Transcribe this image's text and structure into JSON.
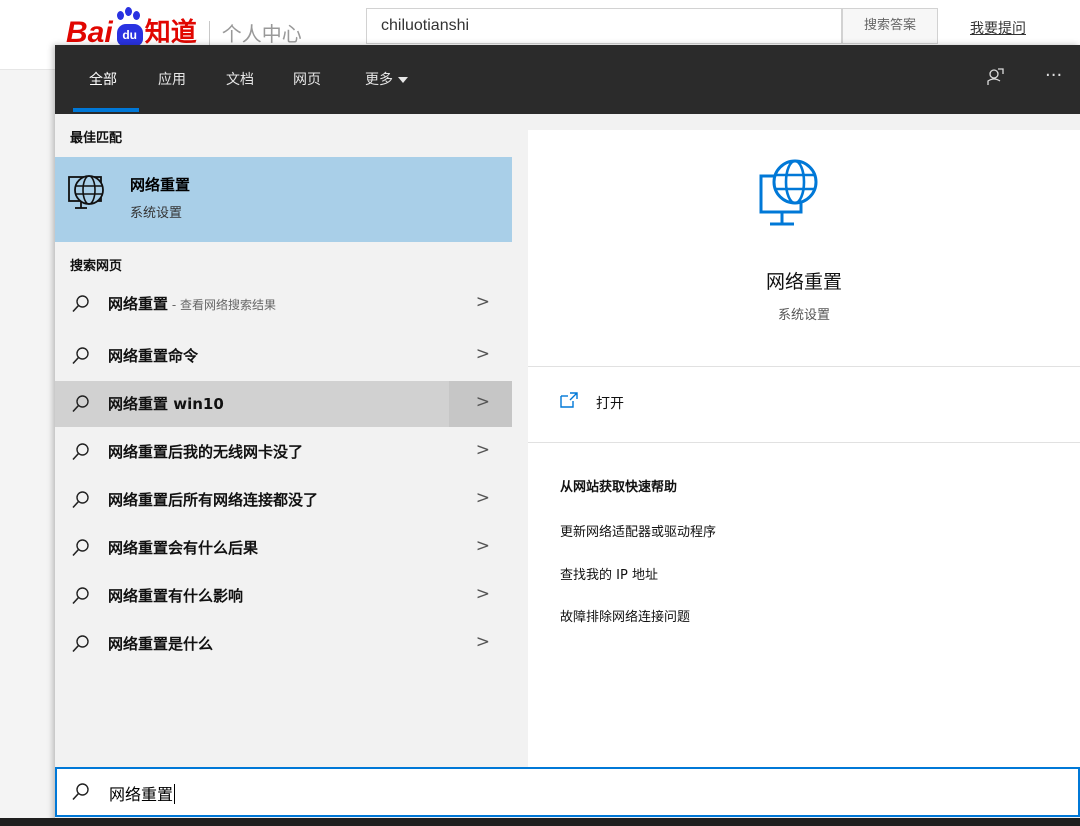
{
  "baidu": {
    "logo_bai": "Bai",
    "logo_du": "du",
    "logo_zhidao": "知道",
    "personal_center": "个人中心",
    "search_value": "chiluotianshi",
    "search_button": "搜索答案",
    "ask_link": "我要提问"
  },
  "tabs": [
    {
      "label": "全部",
      "active": true
    },
    {
      "label": "应用"
    },
    {
      "label": "文档"
    },
    {
      "label": "网页"
    },
    {
      "label": "更多"
    }
  ],
  "toolbar": {
    "feedback_icon": "feedback-icon",
    "more_glyph": "···"
  },
  "best_match": {
    "header": "最佳匹配",
    "title": "网络重置",
    "subtitle": "系统设置"
  },
  "web_search": {
    "header": "搜索网页",
    "items": [
      {
        "text": "网络重置",
        "hint": " - 查看网络搜索结果"
      },
      {
        "text": "网络重置命令"
      },
      {
        "text": "网络重置 win10"
      },
      {
        "text": "网络重置后我的无线网卡没了"
      },
      {
        "text": "网络重置后所有网络连接都没了"
      },
      {
        "text": "网络重置会有什么后果"
      },
      {
        "text": "网络重置有什么影响"
      },
      {
        "text": "网络重置是什么"
      }
    ]
  },
  "detail": {
    "title": "网络重置",
    "subtitle": "系统设置",
    "open_label": "打开",
    "help_header": "从网站获取快速帮助",
    "help_links": [
      "更新网络适配器或驱动程序",
      "查找我的 IP 地址",
      "故障排除网络连接问题"
    ]
  },
  "search_box": {
    "value": "网络重置"
  },
  "colors": {
    "accent": "#0078d7",
    "selected": "#a9cfe8",
    "topbar": "#2b2b2b"
  }
}
